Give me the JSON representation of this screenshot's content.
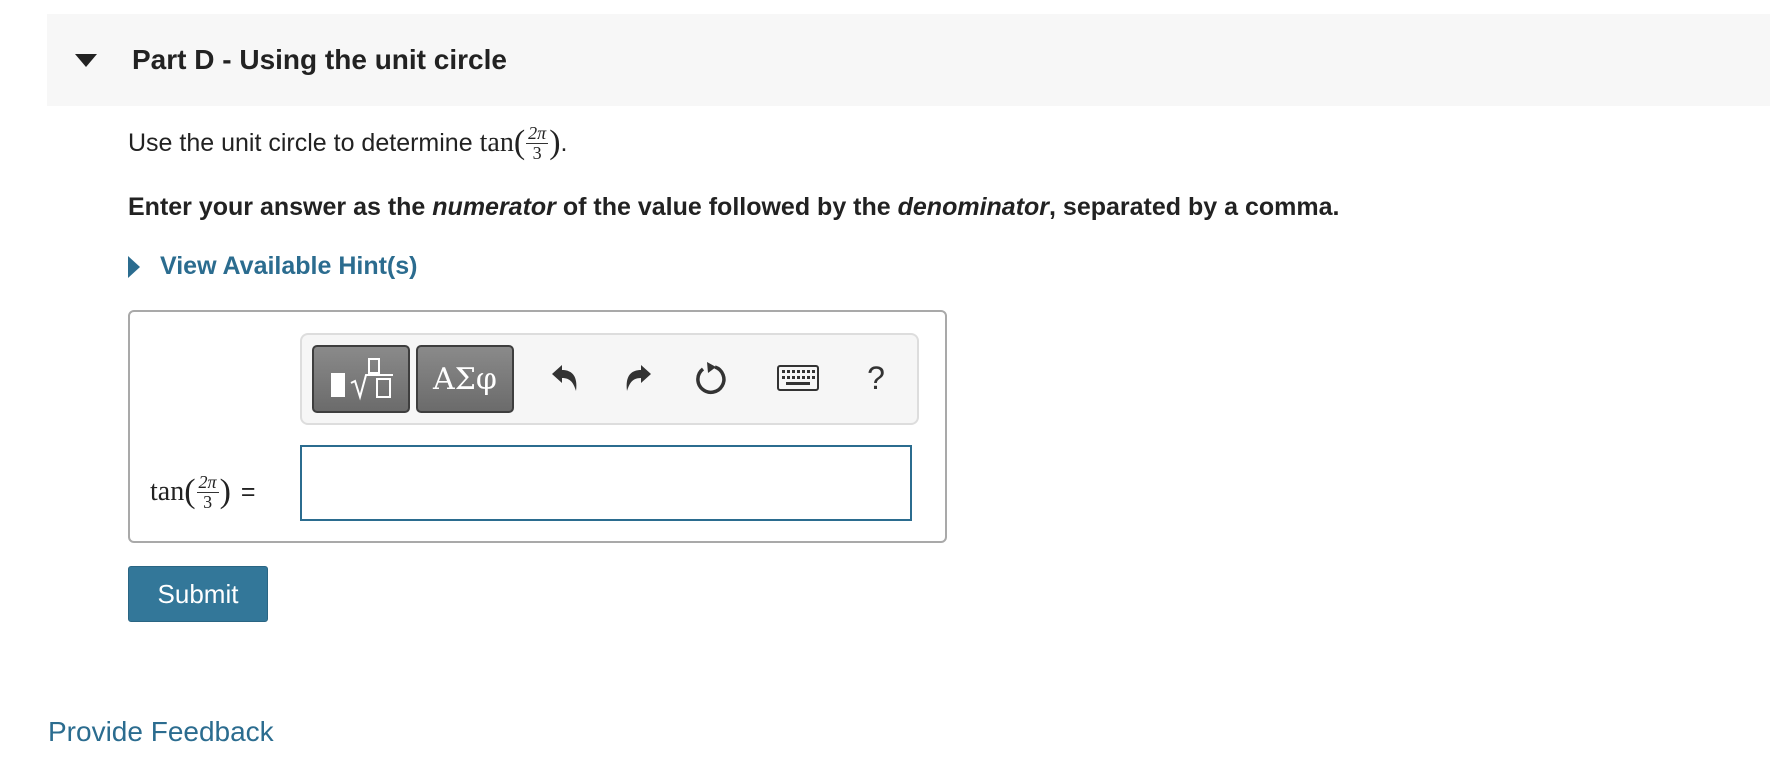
{
  "part": {
    "title": "Part D - Using the unit circle"
  },
  "question": {
    "prompt_text": "Use the unit circle to determine",
    "func": "tan",
    "open_paren": "(",
    "close_paren": ")",
    "period": ".",
    "numerator": "2π",
    "denominator": "3",
    "instructions": {
      "part1": "Enter your answer as the ",
      "em1": "numerator",
      "part2": " of the value followed by the ",
      "em2": "denominator",
      "part3": ", separated by a comma."
    }
  },
  "hints": {
    "label": "View Available Hint(s)"
  },
  "toolbar": {
    "templates_icon": "fraction-root-template-icon",
    "symbols_label": "ΑΣφ",
    "undo_icon": "undo-icon",
    "redo_icon": "redo-icon",
    "reset_icon": "reset-icon",
    "keyboard_icon": "keyboard-icon",
    "help_label": "?"
  },
  "answer": {
    "label_func": "tan",
    "label_numerator": "2π",
    "label_denominator": "3",
    "equals": "=",
    "value": "",
    "placeholder": ""
  },
  "submit": {
    "label": "Submit"
  },
  "feedback": {
    "label": "Provide Feedback"
  },
  "colors": {
    "link": "#2b6c8f",
    "submit_bg": "#337799",
    "header_bg": "#f7f7f7",
    "input_border": "#2b6c8f"
  }
}
